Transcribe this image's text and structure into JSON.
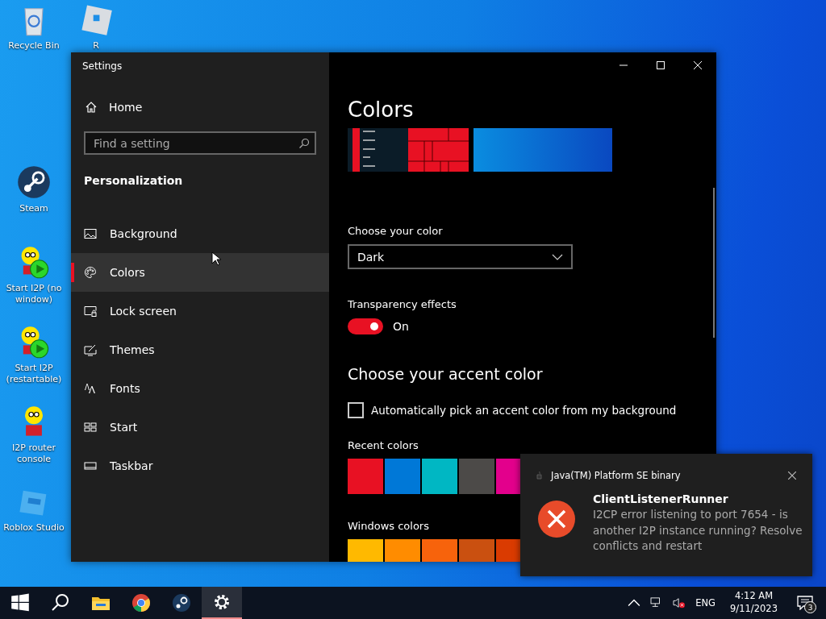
{
  "desktop_icons": [
    {
      "kind": "recycle",
      "label": "Recycle Bin"
    },
    {
      "kind": "roblox",
      "label": "R"
    },
    {
      "kind": "steam",
      "label": "Steam"
    },
    {
      "kind": "i2p-play",
      "label": "Start I2P (no window)"
    },
    {
      "kind": "i2p-play",
      "label": "Start I2P (restartable)"
    },
    {
      "kind": "i2p",
      "label": "I2P router console"
    },
    {
      "kind": "studio",
      "label": "Roblox Studio"
    }
  ],
  "settings_window": {
    "title": "Settings",
    "sidebar": {
      "home": "Home",
      "search": {
        "placeholder": "Find a setting"
      },
      "section": "Personalization",
      "items": [
        {
          "kind": "background",
          "label": "Background",
          "selected": false
        },
        {
          "kind": "colors",
          "label": "Colors",
          "selected": true
        },
        {
          "kind": "lock",
          "label": "Lock screen",
          "selected": false
        },
        {
          "kind": "themes",
          "label": "Themes",
          "selected": false
        },
        {
          "kind": "fonts",
          "label": "Fonts",
          "selected": false
        },
        {
          "kind": "start",
          "label": "Start",
          "selected": false
        },
        {
          "kind": "taskbar",
          "label": "Taskbar",
          "selected": false
        }
      ]
    },
    "content": {
      "heading": "Colors",
      "choose_color": {
        "label": "Choose your color",
        "value": "Dark"
      },
      "transparency": {
        "label": "Transparency effects",
        "on": true,
        "state_text": "On"
      },
      "accent_heading": "Choose your accent color",
      "auto_pick": {
        "label": "Automatically pick an accent color from my background",
        "checked": false
      },
      "recent_colors": {
        "label": "Recent colors",
        "swatches": [
          {
            "color": "#e81123"
          },
          {
            "color": "#0078d7"
          },
          {
            "color": "#00b7c3"
          },
          {
            "color": "#4c4a48"
          },
          {
            "color": "#e3008c"
          }
        ]
      },
      "windows_colors": {
        "label": "Windows colors",
        "swatches": [
          {
            "color": "#ffb900"
          },
          {
            "color": "#ff8c00"
          },
          {
            "color": "#f7630c"
          },
          {
            "color": "#ca5010"
          },
          {
            "color": "#da3b01"
          }
        ]
      }
    }
  },
  "notification": {
    "app": "Java(TM) Platform SE binary",
    "title": "ClientListenerRunner",
    "message": "I2CP error listening to port 7654 - is another I2P instance running? Resolve conflicts and restart"
  },
  "taskbar": {
    "apps": [
      {
        "kind": "search",
        "active": false
      },
      {
        "kind": "explorer",
        "active": false
      },
      {
        "kind": "chrome",
        "active": false
      },
      {
        "kind": "steam",
        "active": false
      },
      {
        "kind": "settings",
        "active": true
      }
    ],
    "language": "ENG",
    "time": "4:12 AM",
    "date": "9/11/2023",
    "notification_count": "3"
  }
}
